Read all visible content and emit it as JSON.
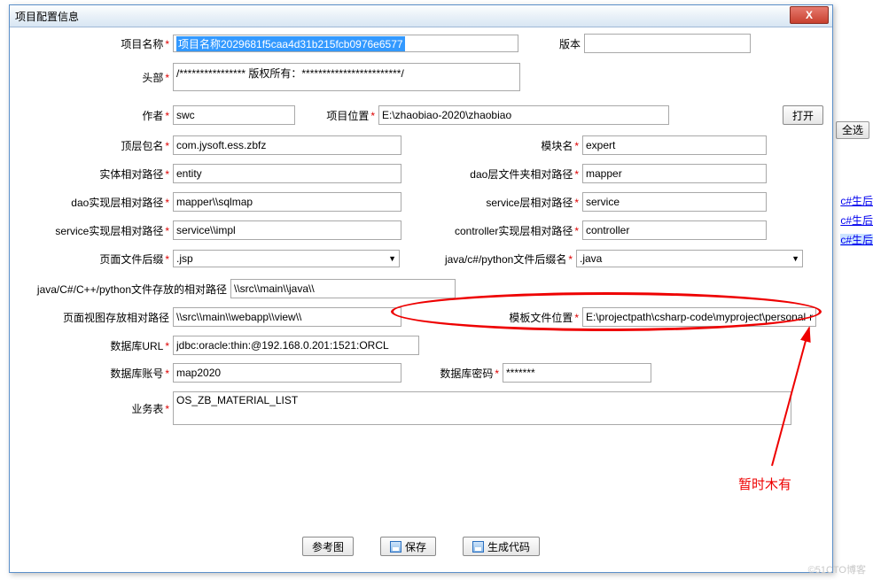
{
  "window": {
    "title": "项目配置信息",
    "close": "X"
  },
  "labels": {
    "project_name": "项目名称",
    "version": "版本",
    "header": "头部",
    "author": "作者",
    "project_location": "项目位置",
    "open": "打开",
    "top_package": "顶层包名",
    "module_name": "模块名",
    "entity_path": "实体相对路径",
    "dao_folder_path": "dao层文件夹相对路径",
    "dao_impl_path": "dao实现层相对路径",
    "service_path": "service层相对路径",
    "service_impl_path": "service实现层相对路径",
    "controller_impl_path": "controller实现层相对路径",
    "page_suffix": "页面文件后缀",
    "code_suffix": "java/c#/python文件后缀名",
    "code_store_path": "java/C#/C++/python文件存放的相对路径",
    "view_store_path": "页面视图存放相对路径",
    "template_location": "模板文件位置",
    "db_url": "数据库URL",
    "db_account": "数据库账号",
    "db_password": "数据库密码",
    "biz_table": "业务表"
  },
  "values": {
    "project_name": "项目名称2029681f5caa4d31b215fcb0976e6577",
    "version": "",
    "header": "/**************** 版权所有：************************/",
    "author": "swc",
    "project_location": "E:\\zhaobiao-2020\\zhaobiao",
    "top_package": "com.jysoft.ess.zbfz",
    "module_name": "expert",
    "entity_path": "entity",
    "dao_folder_path": "mapper",
    "dao_impl_path": "mapper\\\\sqlmap",
    "service_path": "service",
    "service_impl_path": "service\\\\impl",
    "controller_impl_path": "controller",
    "page_suffix": ".jsp",
    "code_suffix": ".java",
    "code_store_path": "\\\\src\\\\main\\\\java\\\\",
    "view_store_path": "\\\\src\\\\main\\\\webapp\\\\view\\\\",
    "template_location": "E:\\projectpath\\csharp-code\\myproject\\personal-manag",
    "db_url": "jdbc:oracle:thin:@192.168.0.201:1521:ORCL",
    "db_account": "map2020",
    "db_password": "*******",
    "biz_table": "OS_ZB_MATERIAL_LIST"
  },
  "buttons": {
    "open": "打开",
    "ref_image": "参考图",
    "save": "保存",
    "gen_code": "生成代码"
  },
  "annotation": {
    "note": "暂时木有"
  },
  "background": {
    "select_all": "全选",
    "link1": "c#生后",
    "link2": "c#生后",
    "link3": "c#生后"
  },
  "watermark": "©51CTO博客"
}
